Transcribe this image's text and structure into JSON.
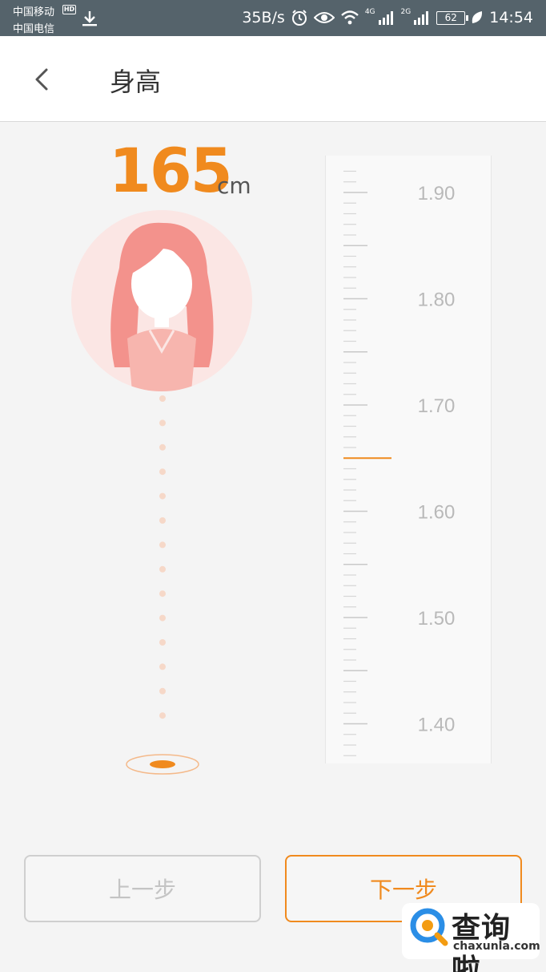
{
  "status_bar": {
    "carrier_1": "中国移动",
    "hd_badge": "HD",
    "carrier_2": "中国电信",
    "net_speed": "35B/s",
    "net_4g": "4G",
    "net_2g": "2G",
    "battery": "62",
    "time": "14:54"
  },
  "header": {
    "title": "身高"
  },
  "height": {
    "value": "165",
    "unit": "cm",
    "current": 1.65
  },
  "ruler": {
    "labels": [
      "1.90",
      "1.80",
      "1.70",
      "1.60",
      "1.50",
      "1.40"
    ],
    "min": 1.37,
    "max": 1.92,
    "selected": 1.65,
    "accent": "#f08a1e"
  },
  "buttons": {
    "prev": "上一步",
    "next": "下一步"
  },
  "watermark": {
    "title": "查询啦",
    "domain": "chaxunla.com"
  },
  "colors": {
    "accent": "#f08a1e",
    "avatar_bg": "#fbe6e4",
    "avatar_figure": "#f3928c"
  }
}
